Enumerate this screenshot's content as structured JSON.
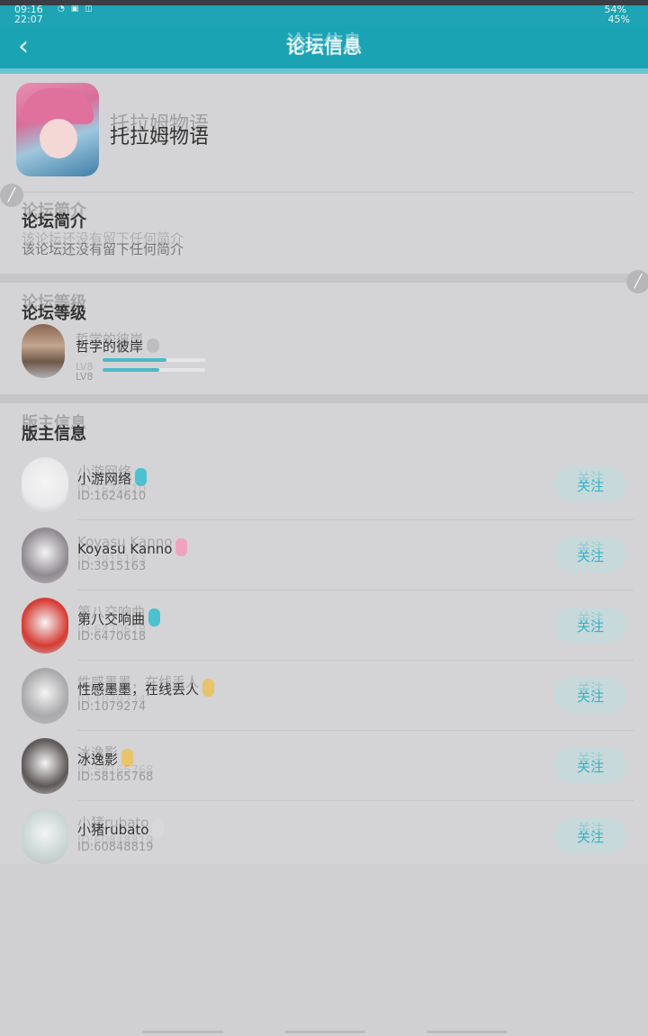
{
  "status_bar": {
    "time_primary": "09:16",
    "time_secondary": "22:07",
    "right_primary": "54%",
    "right_secondary": "45%"
  },
  "header": {
    "title": "论坛信息",
    "back_icon": "chevron-left-icon"
  },
  "forum": {
    "name": "托拉姆物语",
    "intro_title": "论坛简介",
    "intro_text": "该论坛还没有留下任何简介"
  },
  "level": {
    "section_title": "论坛等级",
    "user_name": "哲学的彼岸",
    "level_label": "LV8",
    "progress_top": 0.62,
    "progress_bottom": 0.55
  },
  "moderators": {
    "section_title": "版主信息",
    "follow_label": "关注",
    "items": [
      {
        "name": "小游网络",
        "id": "ID:1624610",
        "badge_color": "#4cc1cf",
        "avatar_color": "#e9e9eb"
      },
      {
        "name": "Koyasu Kanno",
        "id": "ID:3915163",
        "badge_color": "#f0a3bf",
        "avatar_color": "#8f8a90"
      },
      {
        "name": "第八交响曲",
        "id": "ID:6470618",
        "badge_color": "#4cc1cf",
        "avatar_color": "#d63a32"
      },
      {
        "name": "性感墨墨，在线丢人",
        "id": "ID:1079274",
        "badge_color": "#e8c46a",
        "avatar_color": "#a9a9ab"
      },
      {
        "name": "冰逸影",
        "id": "ID:58165768",
        "badge_color": "#e8c46a",
        "avatar_color": "#5e5858"
      },
      {
        "name": "小猪rubato",
        "id": "ID:60848819",
        "badge_color": "#d9d9db",
        "avatar_color": "#c9d6d4"
      }
    ]
  }
}
